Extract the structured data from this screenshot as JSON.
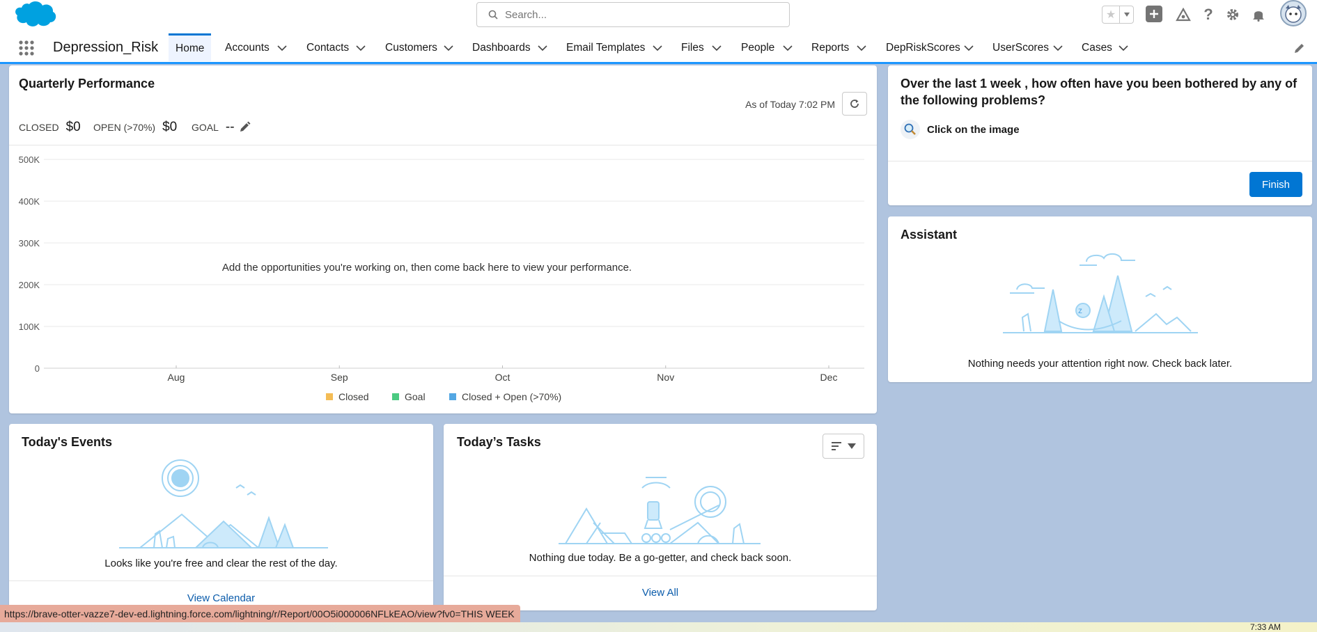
{
  "header": {
    "search_placeholder": "Search..."
  },
  "nav": {
    "app_name": "Depression_Risk",
    "items": [
      {
        "label": "Home",
        "active": true
      },
      {
        "label": "Accounts"
      },
      {
        "label": "Contacts"
      },
      {
        "label": "Customers"
      },
      {
        "label": "Dashboards"
      },
      {
        "label": "Email Templates"
      },
      {
        "label": "Files"
      },
      {
        "label": "People"
      },
      {
        "label": "Reports"
      },
      {
        "label": "DepRiskScores"
      },
      {
        "label": "UserScores"
      },
      {
        "label": "Cases"
      }
    ]
  },
  "performance": {
    "title": "Quarterly Performance",
    "as_of": "As of Today 7:02 PM",
    "closed_label": "CLOSED",
    "closed_value": "$0",
    "open_label": "OPEN (>70%)",
    "open_value": "$0",
    "goal_label": "GOAL",
    "goal_value": "--",
    "empty_message": "Add the opportunities you're working on, then come back here to view your performance."
  },
  "chart_data": {
    "type": "line",
    "categories": [
      "Aug",
      "Sep",
      "Oct",
      "Nov",
      "Dec"
    ],
    "y_ticks": [
      "500K",
      "400K",
      "300K",
      "200K",
      "100K",
      "0"
    ],
    "ylim": [
      0,
      500000
    ],
    "series": [
      {
        "name": "Closed",
        "values": [],
        "color": "#f4bc55"
      },
      {
        "name": "Goal",
        "values": [],
        "color": "#4bca81"
      },
      {
        "name": "Closed + Open (>70%)",
        "values": [],
        "color": "#54a7e3"
      }
    ],
    "grid": true,
    "legend": "bottom"
  },
  "survey": {
    "question": "Over the last 1 week , how often have you been bothered by any of the following problems?",
    "help_text": "Click on the image",
    "finish_label": "Finish"
  },
  "assistant": {
    "title": "Assistant",
    "message": "Nothing needs your attention right now. Check back later."
  },
  "events": {
    "title": "Today's Events",
    "message": "Looks like you're free and clear the rest of the day.",
    "link": "View Calendar"
  },
  "tasks": {
    "title": "Today’s Tasks",
    "message": "Nothing due today. Be a go-getter, and check back soon.",
    "link": "View All"
  },
  "status_bar": {
    "url": "https://brave-otter-vazze7-dev-ed.lightning.force.com/lightning/r/Report/00O5i000006NFLkEAO/view?fv0=THIS WEEK",
    "clock": "7:33 AM"
  },
  "colors": {
    "brand_blue": "#0176d3",
    "nav_active_bar": "#1b96ff",
    "background": "#b0c4df",
    "illustration": "#9fd4f3"
  }
}
